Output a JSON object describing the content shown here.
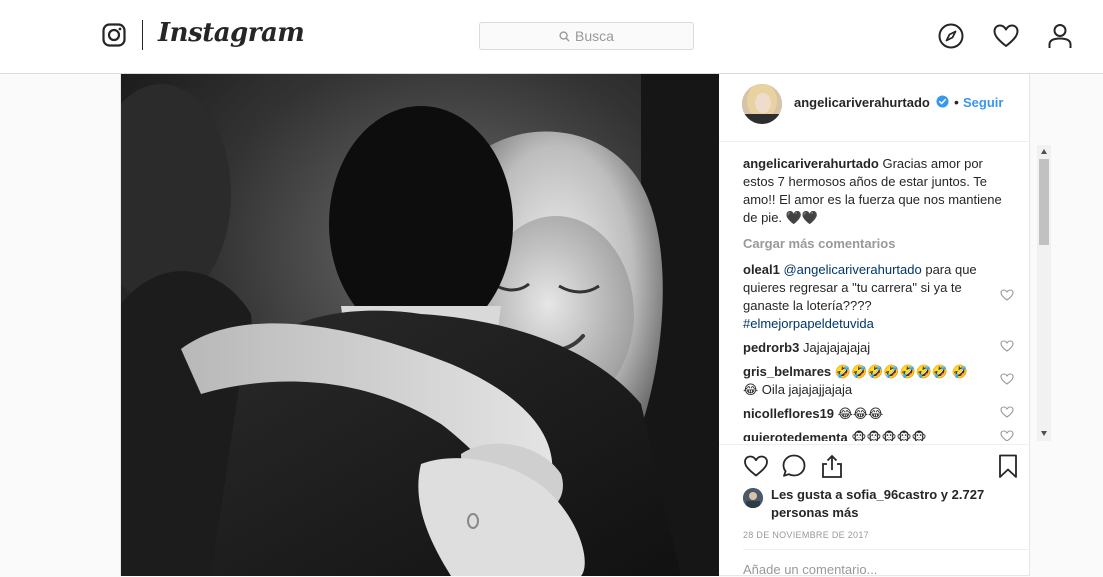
{
  "app": {
    "brand": "Instagram",
    "search_placeholder": "Busca"
  },
  "nav": {
    "icons": [
      "explore-icon",
      "heart-icon",
      "profile-icon"
    ]
  },
  "post": {
    "username": "angelicariverahurtado",
    "follow_label": "Seguir",
    "dot": "•",
    "caption_user": "angelicariverahurtado",
    "caption_text": "Gracias amor por estos 7 hermosos años de estar juntos. Te amo!! El amor es la fuerza que nos mantiene de pie. 🖤🖤",
    "load_more": "Cargar más comentarios",
    "comments": [
      {
        "user": "oleal1",
        "mention": "@angelicariverahurtado",
        "text": "para que quieres regresar a \"tu carrera\" si ya te ganaste la lotería????",
        "hashtag": "#elmejorpapeldetuvida"
      },
      {
        "user": "pedrorb3",
        "text": "Jajajajajajaj"
      },
      {
        "user": "gris_belmares",
        "text": "🤣🤣🤣🤣🤣🤣🤣 🤣😂 Oila jajajajjajaja"
      },
      {
        "user": "nicolleflores19",
        "text": "😂😂😂"
      },
      {
        "user": "quierotedementa",
        "text": "🐵🐵🐵🐵🐵"
      }
    ],
    "likes_text": "Les gusta a sofia_96castro y 2.727 personas más",
    "date": "28 de noviembre de 2017",
    "add_comment_placeholder": "Añade un comentario..."
  },
  "colors": {
    "link": "#3897f0",
    "border": "#dbdbdb",
    "muted": "#999999",
    "text": "#262626"
  }
}
